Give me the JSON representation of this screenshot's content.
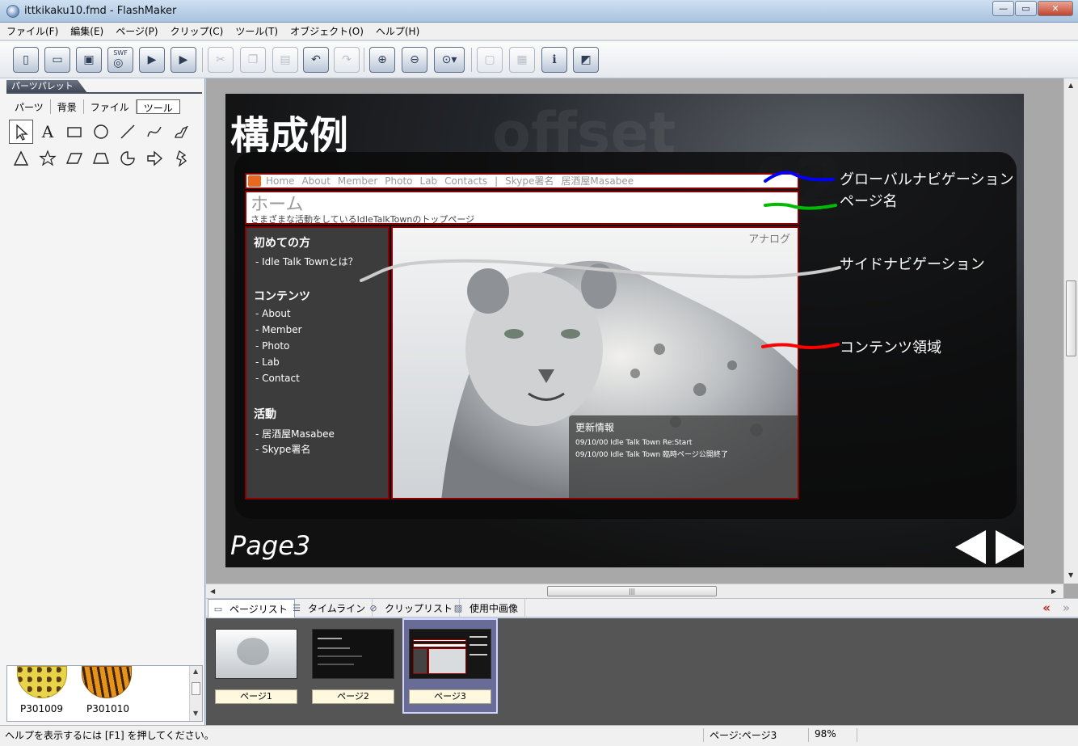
{
  "window": {
    "title": "ittkikaku10.fmd - FlashMaker"
  },
  "menu": [
    "ファイル(F)",
    "編集(E)",
    "ページ(P)",
    "クリップ(C)",
    "ツール(T)",
    "オブジェクト(O)",
    "ヘルプ(H)"
  ],
  "toolbar": {
    "swf_label": "SWF",
    "buttons": [
      {
        "name": "new-file",
        "icon": "new-file-icon",
        "glyph": "▯",
        "enabled": true
      },
      {
        "name": "open-folder",
        "icon": "folder-icon",
        "glyph": "▭",
        "enabled": true
      },
      {
        "name": "save",
        "icon": "save-icon",
        "glyph": "▣",
        "enabled": true
      },
      {
        "name": "export-swf",
        "icon": "swf-icon",
        "glyph": "◎",
        "enabled": true
      },
      {
        "name": "film-preview",
        "icon": "film-icon",
        "glyph": "▶",
        "enabled": true
      },
      {
        "name": "film-export",
        "icon": "film-export-icon",
        "glyph": "▶",
        "enabled": true
      },
      {
        "name": "cut",
        "icon": "scissors-icon",
        "glyph": "✂",
        "enabled": false
      },
      {
        "name": "copy",
        "icon": "copy-icon",
        "glyph": "❐",
        "enabled": false
      },
      {
        "name": "paste",
        "icon": "paste-icon",
        "glyph": "▤",
        "enabled": false
      },
      {
        "name": "undo",
        "icon": "undo-icon",
        "glyph": "↶",
        "enabled": true
      },
      {
        "name": "redo",
        "icon": "redo-icon",
        "glyph": "↷",
        "enabled": false
      },
      {
        "name": "zoom-in",
        "icon": "zoom-in-icon",
        "glyph": "⊕",
        "enabled": true
      },
      {
        "name": "zoom-out",
        "icon": "zoom-out-icon",
        "glyph": "⊖",
        "enabled": true
      },
      {
        "name": "zoom-fit",
        "icon": "zoom-fit-icon",
        "glyph": "⊙▾",
        "enabled": true
      },
      {
        "name": "object-frame",
        "icon": "frame-icon",
        "glyph": "▢",
        "enabled": false
      },
      {
        "name": "object-arrange",
        "icon": "arrange-icon",
        "glyph": "▦",
        "enabled": false
      },
      {
        "name": "info",
        "icon": "info-icon",
        "glyph": "ℹ",
        "enabled": true
      },
      {
        "name": "publish",
        "icon": "publish-icon",
        "glyph": "◩",
        "enabled": true
      }
    ]
  },
  "palette": {
    "header": "パーツパレット",
    "tabs": [
      "パーツ",
      "背景",
      "ファイル",
      "ツール"
    ],
    "active_tab": 3,
    "tools": [
      "pointer-icon",
      "text-icon",
      "rectangle-icon",
      "circle-icon",
      "line-icon",
      "curve-icon",
      "freehand-icon",
      "triangle-icon",
      "star-icon",
      "parallelogram-icon",
      "trapezoid-icon",
      "pie-icon",
      "arrow-icon",
      "lightning-icon"
    ],
    "tool_text_glyph": "A",
    "swatches": [
      {
        "label": "P301009",
        "kind": "leopard"
      },
      {
        "label": "P301010",
        "kind": "tiger"
      }
    ]
  },
  "stage": {
    "title": "構成例",
    "page_label": "Page3",
    "gnav_items": [
      "Home",
      "About",
      "Member",
      "Photo",
      "Lab",
      "Contacts",
      "|",
      "Skype署名",
      "居酒屋Masabee"
    ],
    "page_heading": "ホーム",
    "page_sub": "さまざまな活動をしているIdleTalkTownのトップページ",
    "side": {
      "h1": "初めての方",
      "h1_items": [
        "- Idle Talk Townとは？"
      ],
      "h2": "コンテンツ",
      "h2_items": [
        "- About",
        "- Member",
        "- Photo",
        "- Lab",
        "- Contact"
      ],
      "h3": "活動",
      "h3_items": [
        "- 居酒屋Masabee",
        "- Skype署名"
      ]
    },
    "content_label": "アナログ",
    "news": {
      "title": "更新情報",
      "lines": [
        "09/10/00 Idle Talk Town Re:Start",
        "09/10/00 Idle Talk Town 臨時ページ公開終了"
      ]
    },
    "annotations": [
      {
        "text": "グローバルナビゲーション",
        "color": "#0000ff"
      },
      {
        "text": "ページ名",
        "color": "#00bb00"
      },
      {
        "text": "サイドナビゲーション",
        "color": "#cccccc"
      },
      {
        "text": "コンテンツ領域",
        "color": "#ff0000"
      }
    ]
  },
  "bottom_tabs": [
    {
      "label": "ページリスト",
      "icon": "page-list-icon",
      "active": true
    },
    {
      "label": "タイムライン",
      "icon": "timeline-icon",
      "active": false
    },
    {
      "label": "クリップリスト",
      "icon": "clip-list-icon",
      "active": false
    },
    {
      "label": "使用中画像",
      "icon": "image-icon",
      "active": false
    }
  ],
  "collapse_glyph": "«",
  "expand_glyph": "»",
  "pages": [
    {
      "label": "ページ1"
    },
    {
      "label": "ページ2"
    },
    {
      "label": "ページ3",
      "selected": true
    }
  ],
  "status": {
    "help": "ヘルプを表示するには [F1] を押してください。",
    "page": "ページ:ページ3",
    "zoom": "98%"
  }
}
